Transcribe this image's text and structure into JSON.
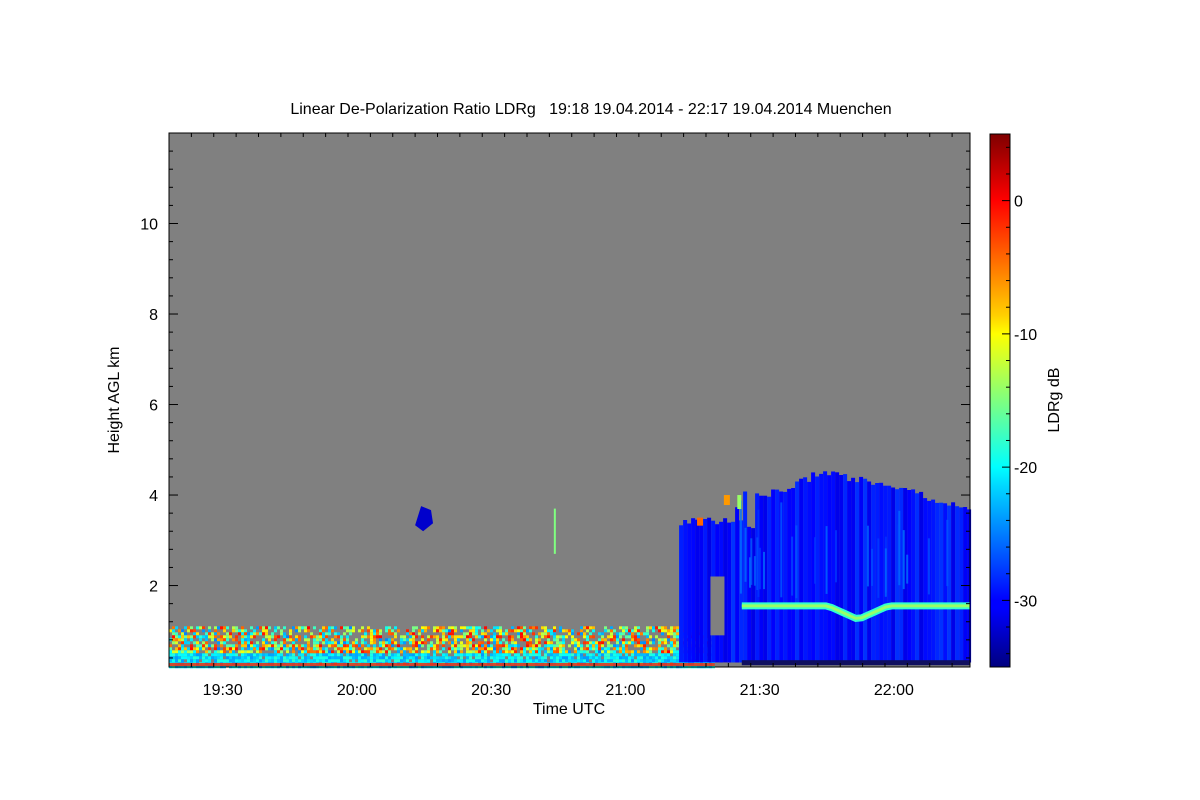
{
  "chart_data": {
    "type": "heatmap",
    "title": "Linear De-Polarization Ratio LDRg   19:18 19.04.2014 - 22:17 19.04.2014 Muenchen",
    "xlabel": "Time UTC",
    "ylabel": "Height AGL km",
    "colorbar_label": "LDRg dB",
    "x_range": [
      "19:18",
      "22:17"
    ],
    "x_ticks": [
      "19:30",
      "20:00",
      "20:30",
      "21:00",
      "21:30",
      "22:00"
    ],
    "ylim": [
      0.2,
      12.0
    ],
    "y_ticks": [
      2,
      4,
      6,
      8,
      10
    ],
    "colorbar_range": [
      -35,
      5
    ],
    "colorbar_ticks": [
      0,
      -10,
      -20,
      -30
    ],
    "colormap": "jet",
    "background_color": "#808080",
    "regions": [
      {
        "name": "aerosol boundary layer noise",
        "x_start": "19:18",
        "x_end": "21:20",
        "height_km": [
          0.2,
          1.1
        ],
        "ldr_db": [
          -25,
          0
        ]
      },
      {
        "name": "isolated cloud patch",
        "x_start": "20:13",
        "x_end": "20:17",
        "height_km": [
          3.2,
          3.8
        ],
        "ldr_db": -32
      },
      {
        "name": "thin vertical trace",
        "x_start": "20:44",
        "x_end": "20:45",
        "height_km": [
          2.7,
          3.7
        ],
        "ldr_db": -15
      },
      {
        "name": "precipitating cloud system",
        "x_start": "21:12",
        "x_end": "22:17",
        "height_km": [
          0.3,
          4.5
        ],
        "ldr_db": -30
      },
      {
        "name": "melting layer bright band",
        "x_start": "21:26",
        "x_end": "22:17",
        "height_km": [
          1.2,
          1.7
        ],
        "ldr_db": -14
      }
    ]
  }
}
